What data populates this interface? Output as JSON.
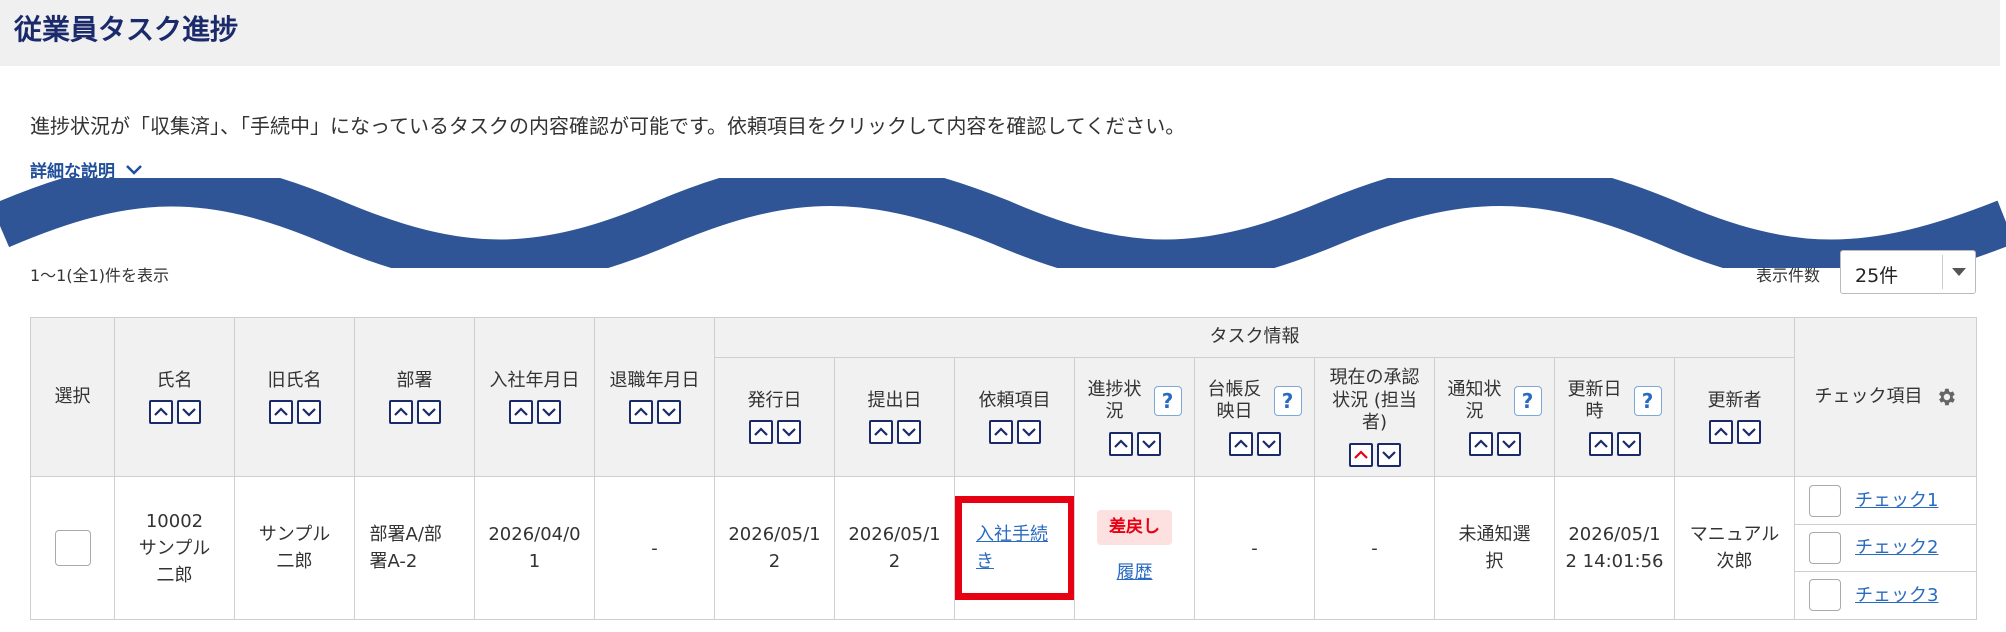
{
  "page": {
    "title": "従業員タスク進捗"
  },
  "intro": {
    "description": "進捗状況が「収集済」、「手続中」になっているタスクの内容確認が可能です。依頼項目をクリックして内容を確認してください。",
    "detail_link": "詳細な説明"
  },
  "listing": {
    "count_text": "1〜1(全1)件を表示",
    "per_page_label": "表示件数",
    "per_page_value": "25件"
  },
  "table": {
    "group_header": "タスク情報",
    "columns": {
      "select": "選択",
      "name": "氏名",
      "old_name": "旧氏名",
      "dept": "部署",
      "hire_date": "入社年月日",
      "retire_date": "退職年月日",
      "issue_date": "発行日",
      "submit_date": "提出日",
      "request_item": "依頼項目",
      "progress": "進捗状況",
      "ledger_date": "台帳反映日",
      "approval": "現在の承認状況 (担当者)",
      "notify": "通知状況",
      "updated_at": "更新日時",
      "updated_by": "更新者",
      "check_items": "チェック項目"
    },
    "rows": [
      {
        "name": "10002 サンプル二郎",
        "old_name": "サンプル二郎",
        "dept": "部署A/部署A-2",
        "hire_date": "2026/04/01",
        "retire_date": "-",
        "issue_date": "2026/05/12",
        "submit_date": "2026/05/12",
        "request_item": "入社手続き",
        "progress_badge": "差戻し",
        "progress_history": "履歴",
        "ledger_date": "-",
        "approval": "-",
        "notify": "未通知選択",
        "updated_at": "2026/05/12 14:01:56",
        "updated_by": "マニュアル　次郎",
        "checks": [
          "チェック1",
          "チェック2",
          "チェック3"
        ]
      }
    ]
  },
  "colors": {
    "title": "#1b2a6b",
    "link": "#2a6bc2",
    "highlight_border": "#e60012",
    "wave": "#2f5597",
    "badge_bg": "#fde0e0"
  },
  "icons": [
    "chevron-down-icon",
    "sort-asc-icon",
    "sort-desc-icon",
    "help-icon",
    "gear-icon",
    "dropdown-caret-icon"
  ]
}
